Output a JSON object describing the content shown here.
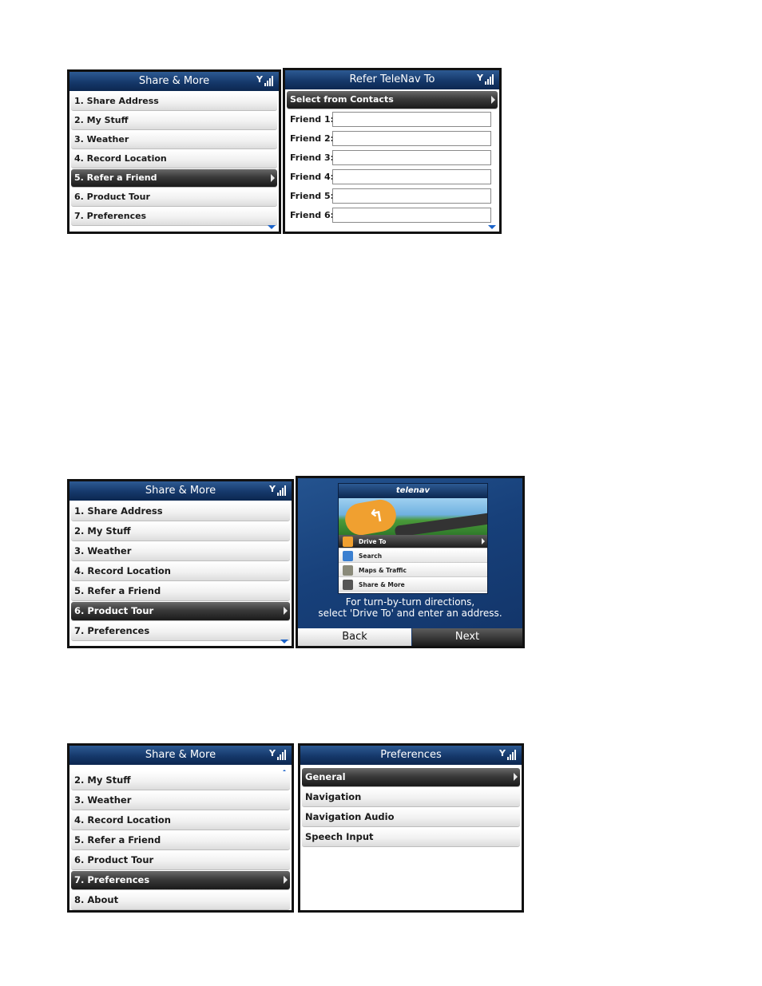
{
  "screen1": {
    "title": "Share & More",
    "items": [
      "1. Share Address",
      "2. My Stuff",
      "3. Weather",
      "4. Record Location",
      "5. Refer a Friend",
      "6. Product Tour",
      "7. Preferences"
    ]
  },
  "screen2": {
    "title": "Refer TeleNav To",
    "select_label": "Select from Contacts",
    "fields": [
      "Friend 1:",
      "Friend 2:",
      "Friend 3:",
      "Friend 4:",
      "Friend 5:",
      "Friend 6:"
    ]
  },
  "screen3": {
    "title": "Share & More",
    "items": [
      "1. Share Address",
      "2. My Stuff",
      "3. Weather",
      "4. Record Location",
      "5. Refer a Friend",
      "6. Product Tour",
      "7. Preferences"
    ]
  },
  "screen4": {
    "brand": "telenav",
    "menu": [
      "Drive To",
      "Search",
      "Maps & Traffic",
      "Share & More"
    ],
    "caption_line1": "For turn-by-turn directions,",
    "caption_line2": "select 'Drive To' and enter an address.",
    "back_label": "Back",
    "next_label": "Next"
  },
  "screen5": {
    "title": "Share & More",
    "items": [
      "2. My Stuff",
      "3. Weather",
      "4. Record Location",
      "5. Refer a Friend",
      "6. Product Tour",
      "7. Preferences",
      "8. About"
    ]
  },
  "screen6": {
    "title": "Preferences",
    "items": [
      "General",
      "Navigation",
      "Navigation Audio",
      "Speech Input"
    ]
  }
}
